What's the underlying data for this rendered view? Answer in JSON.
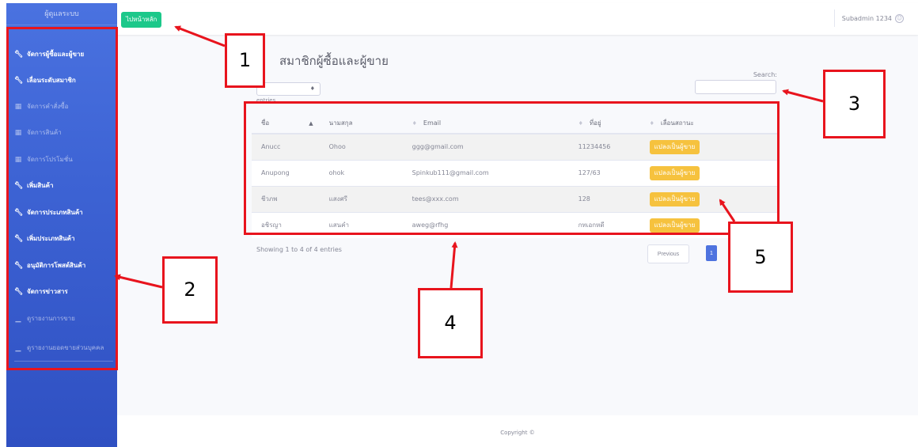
{
  "sidebar": {
    "brand": "ผู้ดูแลระบบ",
    "items": [
      {
        "label": "จัดการผู้ซื้อและผู้ขาย",
        "icon": "wrench-icon",
        "muted": false
      },
      {
        "label": "เลื่อนระดับสมาชิก",
        "icon": "wrench-icon",
        "muted": false
      },
      {
        "label": "จัดการคำสั่งซื้อ",
        "icon": "table-icon",
        "muted": true
      },
      {
        "label": "จัดการสินค้า",
        "icon": "table-icon",
        "muted": true
      },
      {
        "label": "จัดการโปรโมชั่น",
        "icon": "table-icon",
        "muted": true
      },
      {
        "label": "เพิ่มสินค้า",
        "icon": "wrench-icon",
        "muted": false
      },
      {
        "label": "จัดการประเภทสินค้า",
        "icon": "wrench-icon",
        "muted": false
      },
      {
        "label": "เพิ่มประเภทสินค้า",
        "icon": "wrench-icon",
        "muted": false
      },
      {
        "label": "อนุมัติการโพสต์สินค้า",
        "icon": "wrench-icon",
        "muted": false
      },
      {
        "label": "จัดการข่าวสาร",
        "icon": "wrench-icon",
        "muted": false
      },
      {
        "label": "ดูรายงานการขาย",
        "icon": "chart-icon",
        "muted": true
      },
      {
        "label": "ดูรายงานยอดขายส่วนบุคคล",
        "icon": "chart-icon",
        "muted": true
      }
    ]
  },
  "topbar": {
    "home_label": "ไปหน้าหลัก",
    "user_name": "Subadmin 1234",
    "user_icon": "user-circle-icon"
  },
  "main": {
    "title": "สมาชิกผู้ซื้อและผู้ขาย",
    "entries_label": "entries",
    "search_label": "Search:",
    "search_value": ""
  },
  "table": {
    "headers": [
      "ชื่อ",
      "นามสกุล",
      "Email",
      "ที่อยู่",
      "เลื่อนสถานะ"
    ],
    "rows": [
      {
        "first": "Anucc",
        "last": "Ohoo",
        "email": "ggg@gmail.com",
        "address": "11234456",
        "action": "แปลงเป็นผู้ขาย"
      },
      {
        "first": "Anupong",
        "last": "ohok",
        "email": "Spinkub111@gmail.com",
        "address": "127/63",
        "action": "แปลงเป็นผู้ขาย"
      },
      {
        "first": "ชีวภพ",
        "last": "แสงศรี",
        "email": "tees@xxx.com",
        "address": "128",
        "action": "แปลงเป็นผู้ขาย"
      },
      {
        "first": "อชิรญา",
        "last": "แสนคำ",
        "email": "aweg@rfhg",
        "address": "กทเอกหดี",
        "action": "แปลงเป็นผู้ขาย"
      }
    ]
  },
  "pagination": {
    "info": "Showing 1 to 4 of 4 entries",
    "previous": "Previous",
    "current_page": "1"
  },
  "footer": {
    "copyright": "Copyright ©"
  },
  "annotations": [
    "1",
    "2",
    "3",
    "4",
    "5"
  ],
  "colors": {
    "sidebar": "#4a72e0",
    "home_button": "#1cc88a",
    "convert_button": "#f6c23e",
    "page_button": "#4e73df",
    "annotation": "#e8141d"
  }
}
